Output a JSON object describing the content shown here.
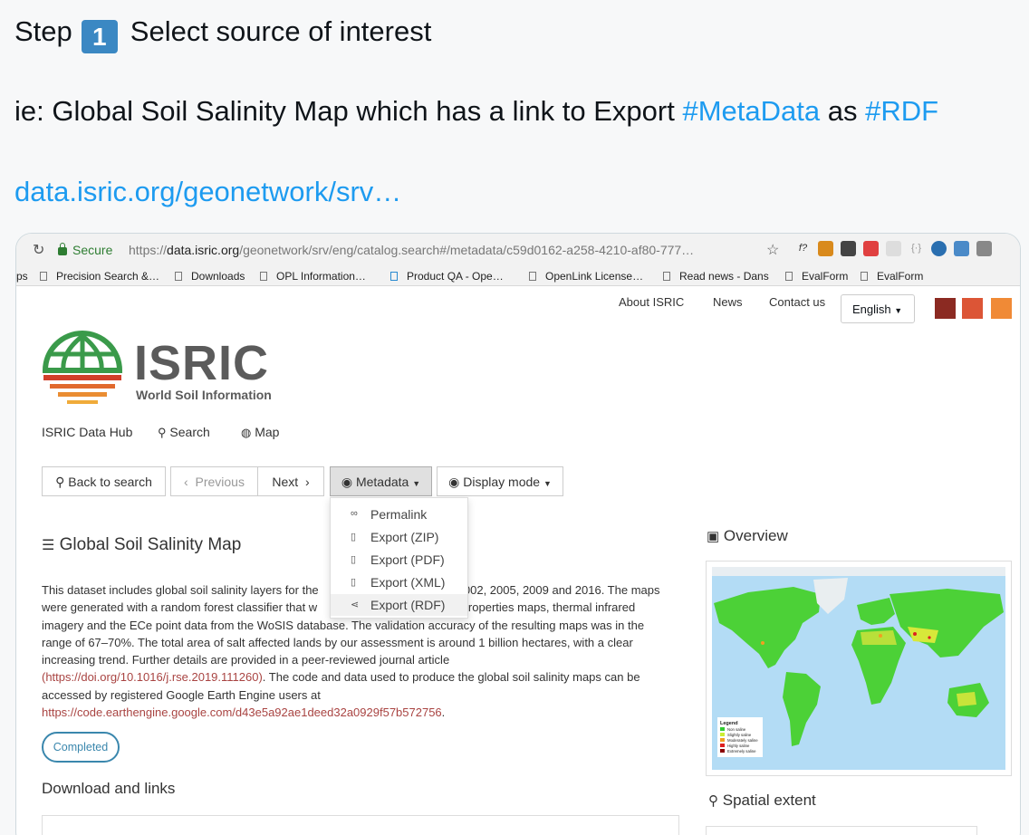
{
  "tweet": {
    "step_prefix": "Step",
    "step_number": "1",
    "step_text": "Select source of interest",
    "line2_prefix": "ie:  Global Soil Salinity Map which has a link to Export ",
    "hashtag_metadata": "#MetaData",
    "line2_mid": " as ",
    "hashtag_rdf": "#RDF",
    "link": "data.isric.org/geonetwork/srv…"
  },
  "browser": {
    "secure_label": "Secure",
    "url_scheme": "https://",
    "url_host": "data.isric.org",
    "url_path": "/geonetwork/srv/eng/catalog.search#/metadata/c59d0162-a258-4210-af80-777…",
    "bookmarks": [
      "ps",
      "Precision Search &…",
      "Downloads",
      "OPL Information…",
      "Product QA - Ope…",
      "OpenLink License…",
      "Read news - Dans",
      "EvalForm",
      "EvalForm"
    ]
  },
  "site": {
    "top_nav": [
      "About ISRIC",
      "News",
      "Contact us"
    ],
    "language": "English",
    "theme_colors": [
      "#8b2a22",
      "#dc5536",
      "#f08a36"
    ],
    "logo_name": "ISRIC",
    "logo_subtitle": "World Soil Information",
    "sub_nav": {
      "hub": "ISRIC Data Hub",
      "search": "Search",
      "map": "Map"
    },
    "toolbar": {
      "back": "Back to search",
      "previous": "Previous",
      "next": "Next",
      "metadata": "Metadata",
      "display_mode": "Display mode"
    },
    "metadata_menu": [
      "Permalink",
      "Export (ZIP)",
      "Export (PDF)",
      "Export (XML)",
      "Export (RDF)"
    ],
    "dataset_title": "Global Soil Salinity Map",
    "description": {
      "l1_a": "This dataset includes global soil salinity layers for the",
      "l1_b": "2002, 2005, 2009 and 2016. The maps",
      "l2_a": "were generated with a random forest classifier that w",
      "l2_b": "l properties maps, thermal infrared",
      "l3": "imagery and the ECe point data from the WoSIS database. The validation accuracy of the resulting maps was in the",
      "l4": "range of 67–70%. The total area of salt affected lands by our assessment is around 1 billion hectares, with a clear",
      "l5": "increasing trend. Further details are provided in a peer-reviewed journal article",
      "l6_link": "(https://doi.org/10.1016/j.rse.2019.111260)",
      "l6_rest": ". The code and data used to produce the global soil salinity maps can be",
      "l7": "accessed by registered Google Earth Engine users at",
      "l8_link": "https://code.earthengine.google.com/d43e5a92ae1deed32a0929f57b572756",
      "l8_rest": "."
    },
    "status_badge": "Completed",
    "downloads_title": "Download and links",
    "overview_title": "Overview",
    "map_legend": {
      "title": "Legend",
      "items": [
        "Non saline",
        "Slightly saline",
        "Moderately saline",
        "Highly saline",
        "Extremely saline"
      ],
      "colors": [
        "#33cc33",
        "#ccee33",
        "#f0a020",
        "#dd2020",
        "#8b0000"
      ]
    },
    "spatial_title": "Spatial extent"
  }
}
